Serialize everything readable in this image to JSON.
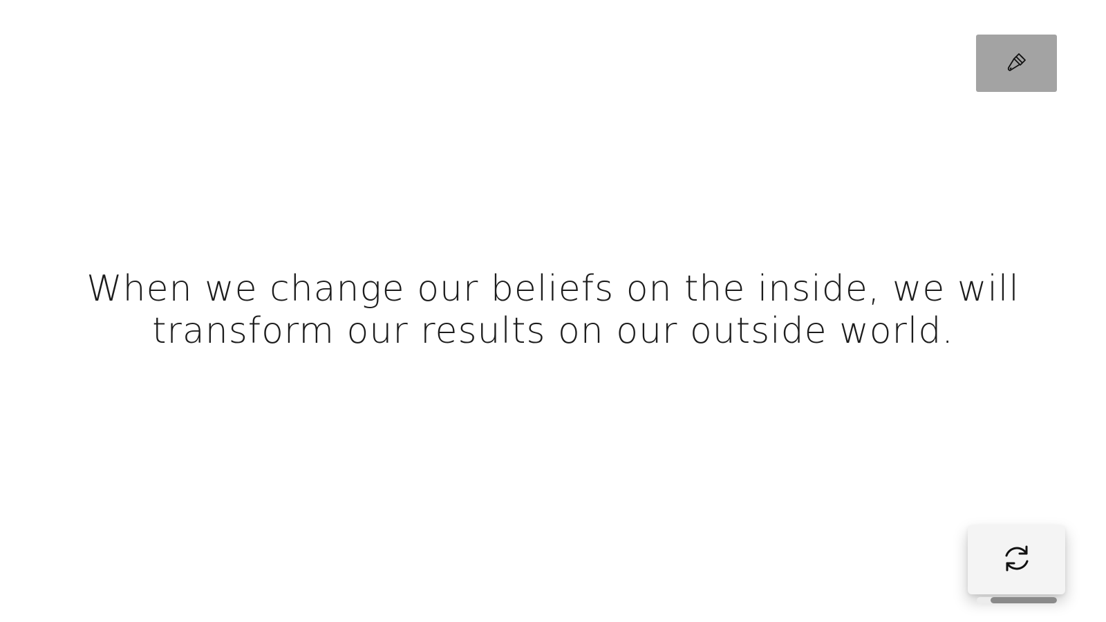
{
  "quote": {
    "text": "When we change our beliefs on the inside, we will transform our results on our outside world."
  },
  "controls": {
    "theme_button_icon": "paintbrush-icon",
    "refresh_button_icon": "refresh-icon"
  },
  "timer": {
    "progress_fraction": 0.83
  },
  "colors": {
    "background": "#ffffff",
    "theme_button_bg": "#a3a3a3",
    "text": "#1c1c1c",
    "card_bg": "#f4f4f4",
    "progress_fill": "#8a8a8a"
  }
}
